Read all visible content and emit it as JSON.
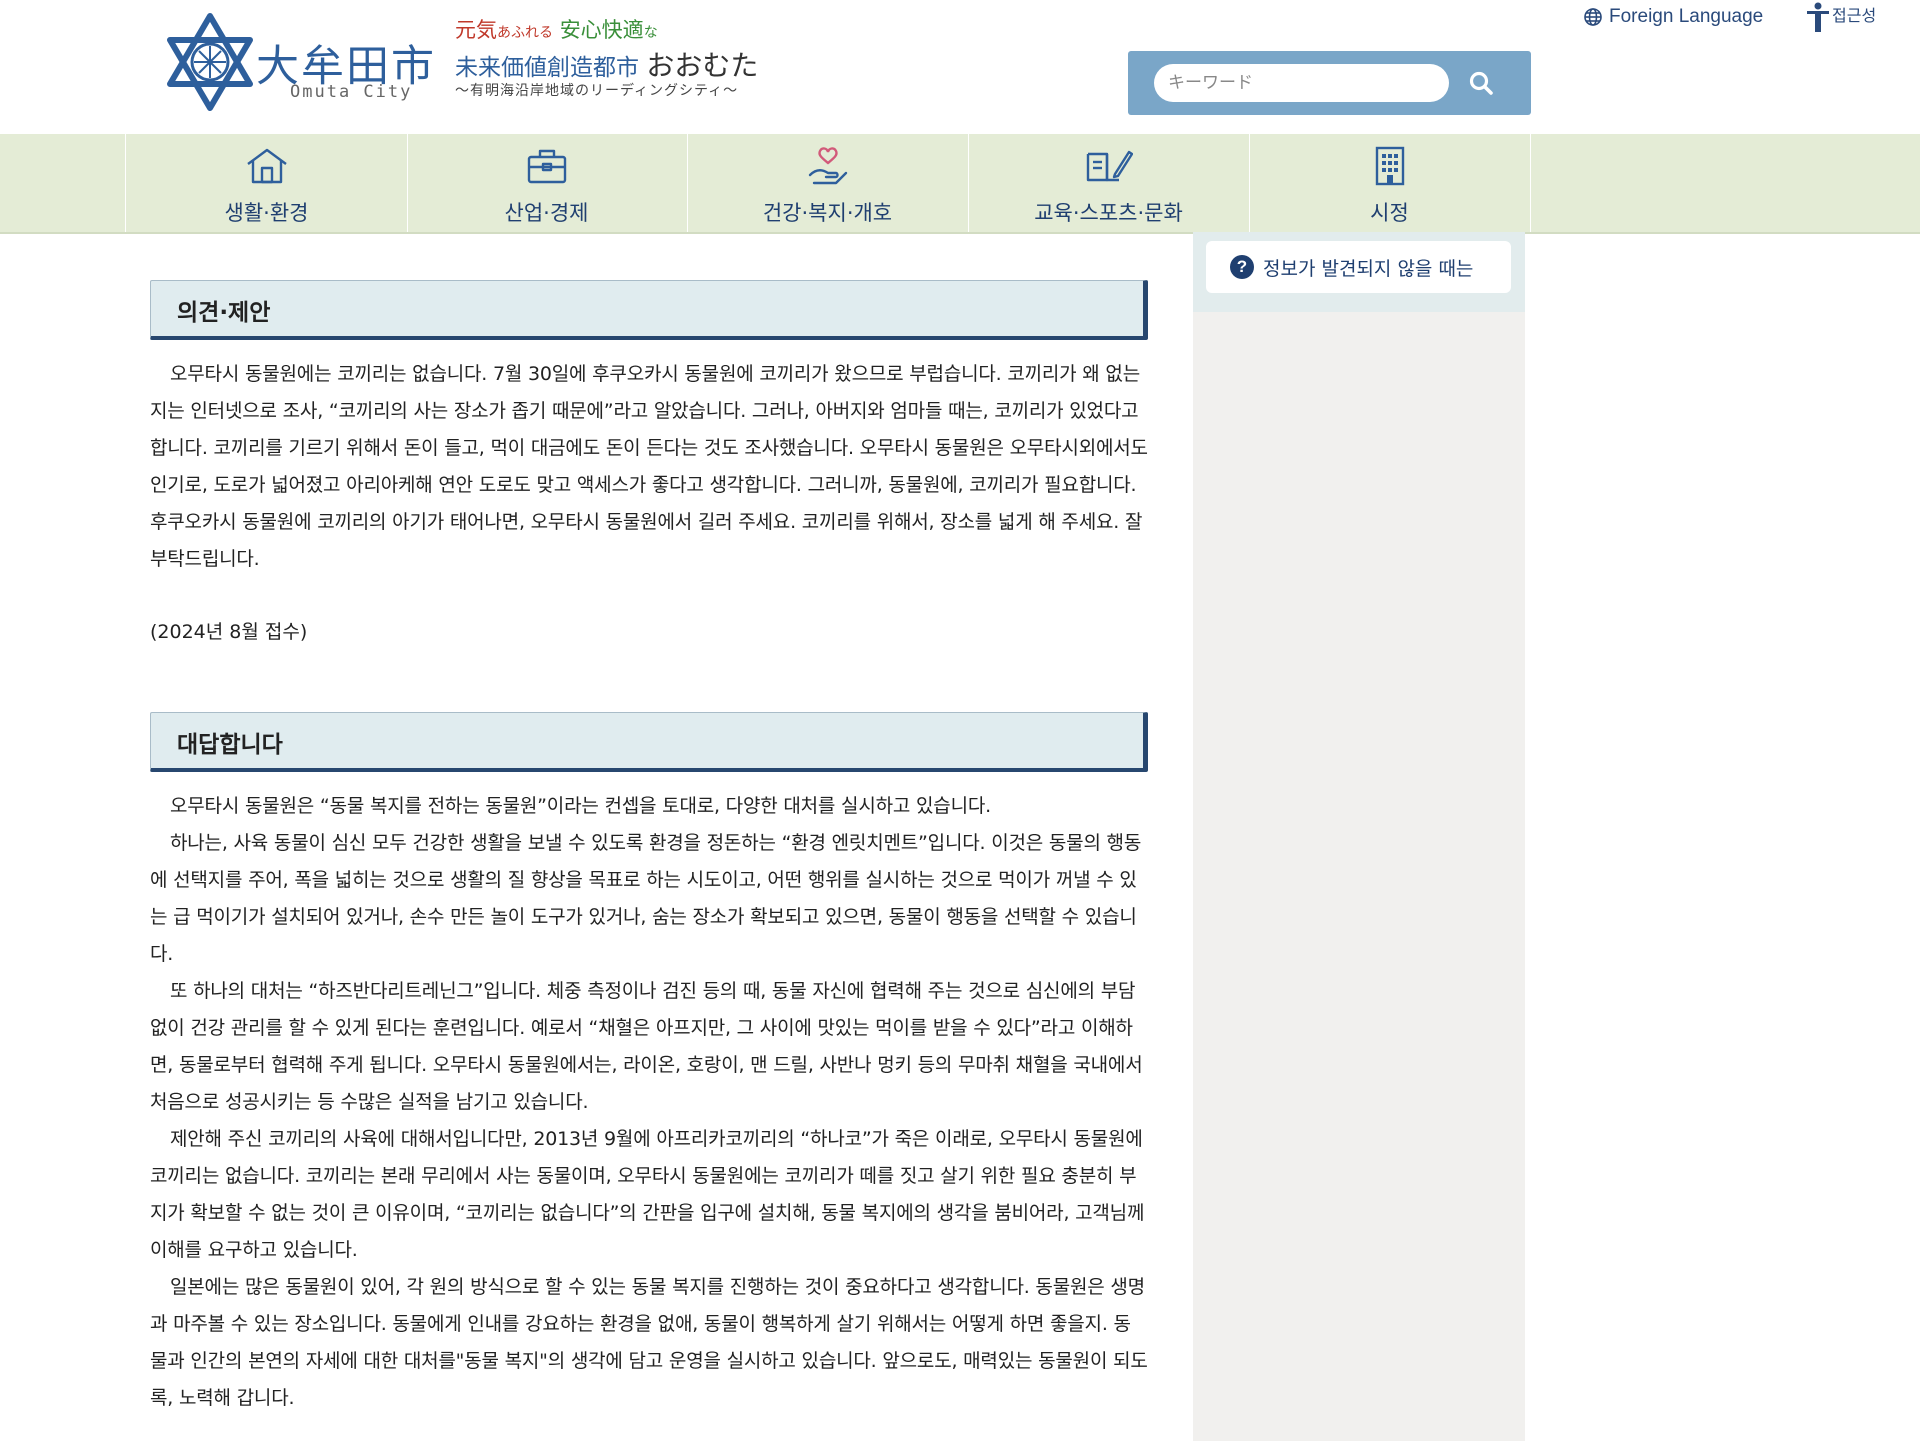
{
  "header": {
    "logo_name": "大牟田市",
    "logo_sub": "Omuta City",
    "tagline": {
      "l1a": "元気",
      "l1b": "あふれる",
      "l1c": "安心快適",
      "l1d": "な",
      "l2a": "未来価値創造都市",
      "l2b": "おおむた",
      "l3": "〜有明海沿岸地域のリーディングシティ〜"
    },
    "foreign_language": "Foreign Language",
    "accessibility": "접근성",
    "search_placeholder": "キーワード"
  },
  "nav": {
    "items": [
      {
        "label": "생활·환경",
        "icon": "house-icon"
      },
      {
        "label": "산업·경제",
        "icon": "briefcase-icon"
      },
      {
        "label": "건강·복지·개호",
        "icon": "heart-hand-icon"
      },
      {
        "label": "교육·스포츠·문화",
        "icon": "book-pen-icon"
      },
      {
        "label": "시정",
        "icon": "building-icon"
      }
    ]
  },
  "sidebar": {
    "not_found": "정보가 발견되지 않을 때는"
  },
  "opinion": {
    "heading": "의견·제안",
    "body": "오무타시 동물원에는 코끼리는 없습니다. 7월 30일에 후쿠오카시 동물원에 코끼리가 왔으므로 부럽습니다. 코끼리가 왜 없는지는 인터넷으로 조사, “코끼리의 사는 장소가 좁기 때문에”라고 알았습니다. 그러나, 아버지와 엄마들 때는, 코끼리가 있었다고 합니다. 코끼리를 기르기 위해서 돈이 들고, 먹이 대금에도 돈이 든다는 것도 조사했습니다. 오무타시 동물원은 오무타시외에서도 인기로, 도로가 넓어졌고 아리아케해 연안 도로도 맞고 액세스가 좋다고 생각합니다. 그러니까, 동물원에, 코끼리가 필요합니다. 후쿠오카시 동물원에 코끼리의 아기가 태어나면, 오무타시 동물원에서 길러 주세요. 코끼리를 위해서, 장소를 넓게 해 주세요. 잘 부탁드립니다.",
    "received": "(2024년 8월 접수)"
  },
  "answer": {
    "heading": "대답합니다",
    "paragraphs": [
      "오무타시 동물원은 “동물 복지를 전하는 동물원”이라는 컨셉을 토대로, 다양한 대처를 실시하고 있습니다.",
      "하나는, 사육 동물이 심신 모두 건강한 생활을 보낼 수 있도록 환경을 정돈하는 “환경 엔릿치멘트”입니다. 이것은 동물의 행동에 선택지를 주어, 폭을 넓히는 것으로 생활의 질 향상을 목표로 하는 시도이고, 어떤 행위를 실시하는 것으로 먹이가 꺼낼 수 있는 급 먹이기가 설치되어 있거나, 손수 만든 놀이 도구가 있거나, 숨는 장소가 확보되고 있으면, 동물이 행동을 선택할 수 있습니다.",
      "또 하나의 대처는 “하즈반다리트레닌그”입니다. 체중 측정이나 검진 등의 때, 동물 자신에 협력해 주는 것으로 심신에의 부담 없이 건강 관리를 할 수 있게 된다는 훈련입니다. 예로서 “채혈은 아프지만, 그 사이에 맛있는 먹이를 받을 수 있다”라고 이해하면, 동물로부터 협력해 주게 됩니다. 오무타시 동물원에서는, 라이온, 호랑이, 맨 드릴, 사반나 멍키 등의 무마취 채혈을 국내에서 처음으로 성공시키는 등 수많은 실적을 남기고 있습니다.",
      "제안해 주신 코끼리의 사육에 대해서입니다만, 2013년 9월에 아프리카코끼리의 “하나코”가 죽은 이래로, 오무타시 동물원에 코끼리는 없습니다. 코끼리는 본래 무리에서 사는 동물이며, 오무타시 동물원에는 코끼리가 떼를 짓고 살기 위한 필요 충분히 부지가 확보할 수 없는 것이 큰 이유이며, “코끼리는 없습니다”의 간판을 입구에 설치해, 동물 복지에의 생각을 붐비어라, 고객님께 이해를 요구하고 있습니다.",
      "일본에는 많은 동물원이 있어, 각 원의 방식으로 할 수 있는 동물 복지를 진행하는 것이 중요하다고 생각합니다. 동물원은 생명과 마주볼 수 있는 장소입니다. 동물에게 인내를 강요하는 환경을 없애, 동물이 행복하게 살기 위해서는 어떻게 하면 좋을지. 동물과 인간의 본연의 자세에 대한 대처를\"동물 복지\"의 생각에 담고 운영을 실시하고 있습니다. 앞으로도, 매력있는 동물원이 되도록, 노력해 갑니다."
    ]
  },
  "colors": {
    "brand_blue": "#2e5f9c",
    "nav_bg": "#e4ecd6",
    "heading_bg": "#e0ecef",
    "heading_border": "#27476f",
    "search_bg": "#7aa6c8"
  }
}
